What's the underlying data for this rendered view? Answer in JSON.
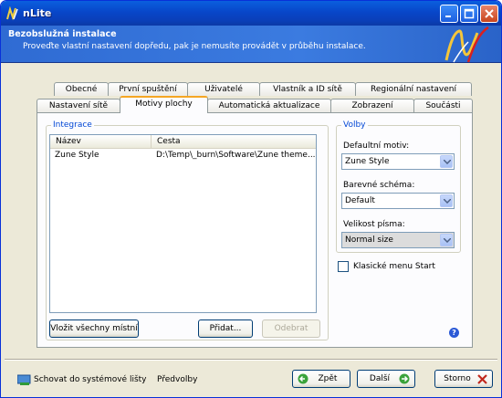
{
  "window": {
    "title": "nLite"
  },
  "header": {
    "title": "Bezobslužná instalace",
    "subtitle": "Proveďte vlastní nastavení dopředu, pak je nemusíte provádět v průběhu instalace."
  },
  "tabs_row1": [
    {
      "label": "Obecné"
    },
    {
      "label": "První spuštění"
    },
    {
      "label": "Uživatelé"
    },
    {
      "label": "Vlastník a ID sítě"
    },
    {
      "label": "Regionální nastavení"
    }
  ],
  "tabs_row2": [
    {
      "label": "Nastavení sítě"
    },
    {
      "label": "Motivy plochy",
      "active": true
    },
    {
      "label": "Automatická aktualizace"
    },
    {
      "label": "Zobrazení"
    },
    {
      "label": "Součásti"
    }
  ],
  "integrace": {
    "legend": "Integrace",
    "columns": [
      "Název",
      "Cesta"
    ],
    "rows": [
      {
        "name": "Zune Style",
        "path": "D:\\Temp\\_burn\\Software\\Zune theme..."
      }
    ],
    "load_all_label": "Vložit všechny místní",
    "add_label": "Přidat...",
    "remove_label": "Odebrat"
  },
  "volby": {
    "legend": "Volby",
    "default_theme_label": "Defaultní motiv:",
    "default_theme_value": "Zune Style",
    "color_scheme_label": "Barevné schéma:",
    "color_scheme_value": "Default",
    "font_size_label": "Velikost písma:",
    "font_size_value": "Normal size",
    "classic_start_label": "Klasické menu Start",
    "classic_start_checked": false
  },
  "footer": {
    "hide_tray_label": "Schovat do systémové lišty",
    "preferences_label": "Předvolby",
    "back_label": "Zpět",
    "next_label": "Další",
    "cancel_label": "Storno"
  },
  "colors": {
    "titlebar": "#0846c9",
    "header": "#3b7be0",
    "accent_tab": "#f5a623",
    "legend": "#0046d5"
  }
}
